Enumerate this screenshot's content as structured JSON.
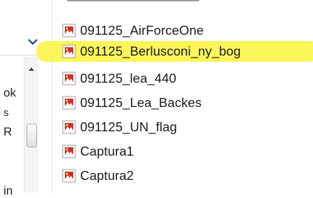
{
  "left_pane": {
    "fragments": [
      "ok",
      "s",
      "R",
      "in"
    ]
  },
  "files": [
    {
      "name": "091125_AirForceOne",
      "highlighted": false,
      "icon": "image-file-icon"
    },
    {
      "name": "091125_Berlusconi_ny_bog",
      "highlighted": true,
      "icon": "image-file-icon"
    },
    {
      "name": "091125_lea_440",
      "highlighted": false,
      "icon": "image-file-icon"
    },
    {
      "name": "091125_Lea_Backes",
      "highlighted": false,
      "icon": "image-file-icon"
    },
    {
      "name": "091125_UN_flag",
      "highlighted": false,
      "icon": "image-file-icon"
    },
    {
      "name": "Captura1",
      "highlighted": false,
      "icon": "image-file-icon"
    },
    {
      "name": "Captura2",
      "highlighted": false,
      "icon": "image-file-icon"
    }
  ],
  "colors": {
    "highlight": "#fdf65a",
    "icon_red": "#c8312a",
    "chevron_blue": "#2b5c8a"
  }
}
